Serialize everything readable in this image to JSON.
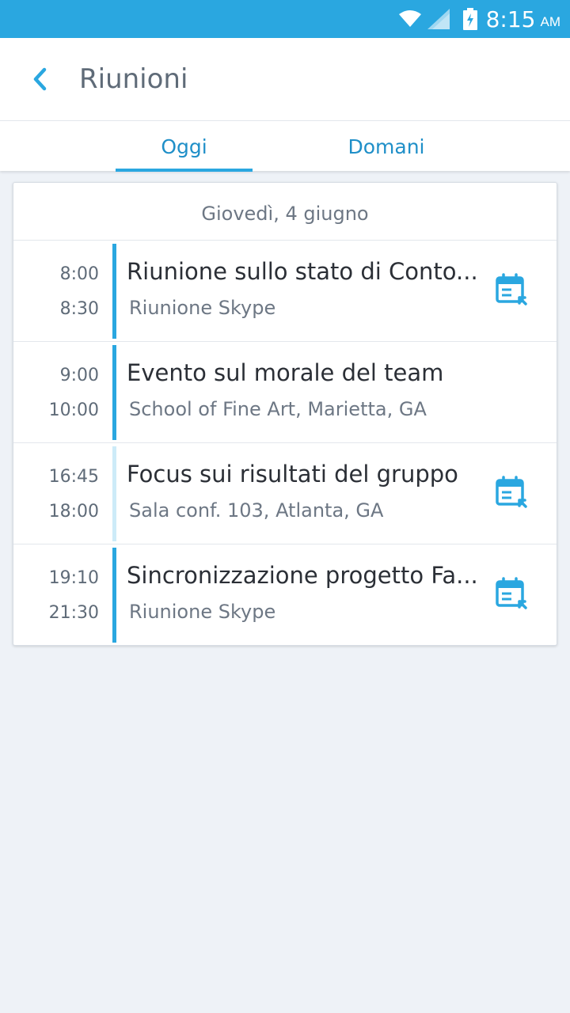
{
  "status_bar": {
    "time": "8:15",
    "ampm": "AM"
  },
  "header": {
    "title": "Riunioni"
  },
  "tabs": [
    {
      "label": "Oggi",
      "active": true
    },
    {
      "label": "Domani",
      "active": false
    }
  ],
  "date_label": "Giovedì, 4 giugno",
  "meetings": [
    {
      "start": "8:00",
      "end": "8:30",
      "title": "Riunione sullo stato di Conto...",
      "location": "Riunione Skype"
    },
    {
      "start": "9:00",
      "end": "10:00",
      "title": "Evento sul morale del team",
      "location": "School of Fine Art, Marietta, GA"
    },
    {
      "start": "16:45",
      "end": "18:00",
      "title": "Focus sui risultati del gruppo",
      "location": "Sala conf. 103, Atlanta, GA"
    },
    {
      "start": "19:10",
      "end": "21:30",
      "title": "Sincronizzazione progetto Fa...",
      "location": "Riunione Skype"
    }
  ],
  "colors": {
    "accent": "#2aa7e0",
    "accent_light": "#cdebf8",
    "background": "#eef2f7"
  }
}
